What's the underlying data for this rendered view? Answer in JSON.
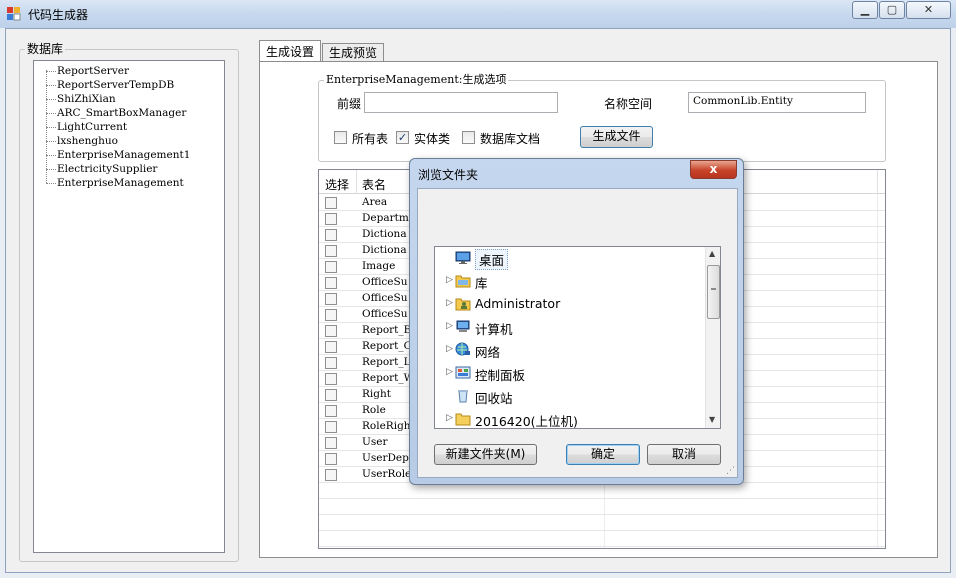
{
  "window": {
    "title": "代码生成器"
  },
  "left_panel": {
    "group_label": "数据库",
    "databases": [
      "ReportServer",
      "ReportServerTempDB",
      "ShiZhiXian",
      "ARC_SmartBoxManager",
      "LightCurrent",
      "lxshenghuo",
      "EnterpriseManagement1",
      "ElectricitySupplier",
      "EnterpriseManagement"
    ]
  },
  "tabs": [
    {
      "label": "生成设置"
    },
    {
      "label": "生成预览"
    }
  ],
  "options": {
    "group_label": "EnterpriseManagement:生成选项",
    "prefix_label": "前缀",
    "prefix_value": "",
    "namespace_label": "名称空间",
    "namespace_value": "CommonLib.Entity",
    "all_tables_label": "所有表",
    "all_tables_checked": false,
    "entity_label": "实体类",
    "entity_checked": true,
    "db_doc_label": "数据库文档",
    "db_doc_checked": false,
    "generate_button": "生成文件"
  },
  "grid": {
    "col_select": "选择",
    "col_table": "表名",
    "rows": [
      "Area",
      "Departme",
      "Dictiona",
      "Dictiona",
      "Image",
      "OfficeSu",
      "OfficeSu",
      "OfficeSu",
      "Report_B",
      "Report_C",
      "Report_L",
      "Report_W",
      "Right",
      "Role",
      "RoleRigh",
      "User",
      "UserDepa",
      "UserRole"
    ]
  },
  "dialog": {
    "title": "浏览文件夹",
    "close_glyph": "x",
    "folders": [
      {
        "label": "桌面",
        "icon": "desktop-icon",
        "expandable": false,
        "selected": true
      },
      {
        "label": "库",
        "icon": "library-icon",
        "expandable": true
      },
      {
        "label": "Administrator",
        "icon": "user-folder-icon",
        "expandable": true
      },
      {
        "label": "计算机",
        "icon": "computer-icon",
        "expandable": true
      },
      {
        "label": "网络",
        "icon": "network-icon",
        "expandable": true
      },
      {
        "label": "控制面板",
        "icon": "control-panel-icon",
        "expandable": true
      },
      {
        "label": "回收站",
        "icon": "recycle-bin-icon",
        "expandable": false
      },
      {
        "label": "2016420(上位机)",
        "icon": "folder-icon",
        "expandable": true
      }
    ],
    "new_folder_button": "新建文件夹(M)",
    "ok_button": "确定",
    "cancel_button": "取消"
  },
  "colors": {
    "accent": "#3c7fb1",
    "selection": "#cce8ff",
    "close_red": "#c7432a"
  }
}
